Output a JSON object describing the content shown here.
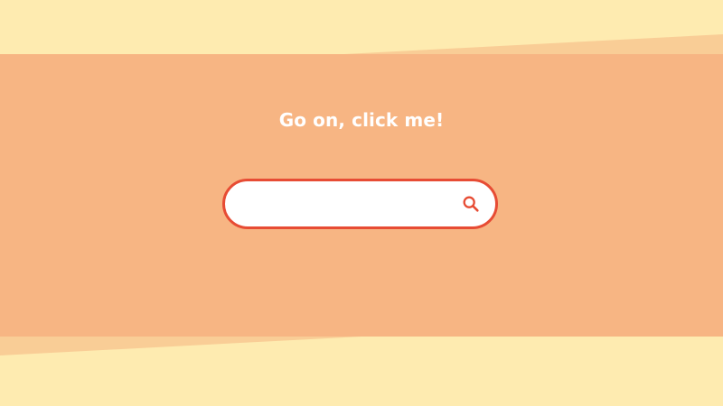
{
  "hero": {
    "cta_text": "Go on, click me!"
  },
  "search": {
    "value": "",
    "placeholder": "",
    "icon": "search-icon"
  },
  "colors": {
    "background": "#feebb0",
    "band_light": "#f9cd96",
    "band_main": "#f7b583",
    "accent": "#e74c34",
    "input_bg": "#ffffff",
    "text": "#ffffff"
  }
}
